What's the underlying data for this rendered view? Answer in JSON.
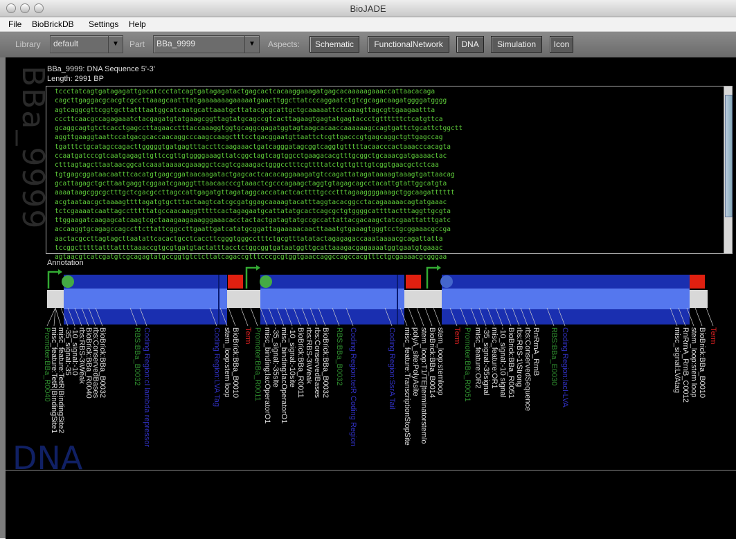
{
  "window": {
    "title": "BioJADE"
  },
  "menu": {
    "items": [
      "File",
      "BioBrickDB",
      "Settings",
      "Help"
    ]
  },
  "toolbar": {
    "library_label": "Library",
    "library_value": "default",
    "part_label": "Part",
    "part_value": "BBa_9999",
    "aspects_label": "Aspects:",
    "aspects": [
      "Schematic",
      "FunctionalNetwork",
      "DNA",
      "Simulation",
      "Icon"
    ]
  },
  "part_watermark": "BBa_9999",
  "aspect_watermark": "DNA",
  "sequence": {
    "header": "BBa_9999: DNA Sequence 5'-3'",
    "length": "Length: 2991 BP",
    "lines": [
      "tccctatcagtgatagagattgacatccctatcagtgatagagatactgagcactcacaaggaaagatgagcacaaaaagaaaccattaacacaga",
      "cagcttgaggacgcacgtcgccttaaagcaatttatgaaaaaaagaaaaatgaacttggcttatcccaggaatctgtcgcagacaagatggggatgggg",
      "agtcaggcgttcggtgcttatttaatggcatcaatgcattaaatgcttatacgcgcattgctgcaaaaattctcaaagttagcgttgaagaattta",
      "cccttcaacgccagagaaatctacgagatgtatgaagcggttagtatgcagccgtcacttagaagtgagtatgagtaccctgttttttctcatgttca",
      "gcaggcagtgtctcacctgagccttagaacctttaccaaaggtggtgcaggcgagatggtagtaagcacaaccaaaaaagccagtgattctgcattctggctt",
      "aggttgaaggtaattccatgacgcaccaacaggcccaagccaagctttcctgacggaatgttaattctcgttgacccgtgagcaggctgttgagccag",
      "tgatttctgcatagccagacttgggggtgatgagtttaccttcaagaaactgatcagggatagcggtcaggtgtttttacaacccactaaacccacagta",
      "ccaatgatcccgtcaatgagagttgttccgttgtggggaaagttatcggctagtcagtggcctgaagacacgtttgcggctgcaaacgatgaaaactac",
      "ctttagtagcttaataacggcatcaaataaaacgaaaggctcagtcgaaagactgggcctttcgttttatctgttgtttgtcggtgaacgctctcaa",
      "tgtgagcggataacaatttcacatgtgagcggataacaagatactgagcactcacacaggaaagatgtccagattatagataaaagtaaagtgattaacag",
      "gcattagagctgcttaatgaggtcggaatcgaaggtttaacaacccgtaaactcgcccagaagctaggtgtagagcagcctacattgtattggcatgta",
      "aaaataagcggcgctttgctcgacgccttagccattgagatgttagataggcaccatactcacttttgccctttagaaggggaaagctggcaagatttttt",
      "acgtaataacgctaaaagttttagatgtgctttactaagtcatcgcgatggagcaaaagtacatttaggtacacggcctacagaaaaacagtatgaaac",
      "tctcgaaaatcaattagcctttttatgccaacaaggtttttcactagagaatgcattatatgcactcagcgctgtggggcattttactttaggttgcgta",
      "ttggaagatcaagagcatcaagtcgctaaagaagaaagggaaacacctactactgatagtatgccgccattattacgacaagctatcgaattatttgatc",
      "accaaggtgcagagccagccttcttattcggccttgaattgatcatatgcggattagaaaaacaacttaaatgtgaaagtgggtcctgcggaaacgccga",
      "aactacgccttagtagcttaatattcacactgcctcaccttcgggtgggcctttctgcgtttatatactagagagaccaaataaaacgcagattatta",
      "tccggctttttatttattttaaaccgtgcgtgatgtactatttacctctggcggtgataatggttgcattaaagacgagaaaatggtgaatgtgaaac",
      "agtaacgtcatcgatgtcgcagagtatgccggtgtctcttatcagaccgtttcccgcgtggtgaaccaggccagccacgtttctgcgaaaacgcgggaa"
    ]
  },
  "annotation": {
    "label": "Annotation",
    "labels": [
      {
        "text": "Promoter:BBa_R0040",
        "color": "#2f8f2f"
      },
      {
        "text": "misc_feature:TetR|BindingSite1",
        "color": "#dddddd"
      },
      {
        "text": "misc_feature:TetR|BindingSite2",
        "color": "#dddddd"
      },
      {
        "text": "-35_signal:-35",
        "color": "#dddddd"
      },
      {
        "text": "-10_signal:-10",
        "color": "#dddddd"
      },
      {
        "text": "rbs:RBS-3\\Weak",
        "color": "#dddddd"
      },
      {
        "text": "BioBrick:BBa_R0040",
        "color": "#dddddd"
      },
      {
        "text": "rbs:ConservedBases",
        "color": "#dddddd"
      },
      {
        "text": "BioBrick:BBa_B0032",
        "color": "#dddddd"
      },
      {
        "text": "RBS:BBa_B0032",
        "color": "#2f8f2f"
      },
      {
        "text": "Coding Region:cI lambda repressor",
        "color": "#3030c0"
      },
      {
        "text": "Coding Region:LVA Tag",
        "color": "#3030c0"
      },
      {
        "text": "stem_loop:stem loop",
        "color": "#dddddd"
      },
      {
        "text": "BioBrick:BBa_B0010",
        "color": "#dddddd"
      },
      {
        "text": "Term",
        "color": "#d02020"
      },
      {
        "text": "Promoter:BBa_R0011",
        "color": "#2f8f2f"
      },
      {
        "text": "misc_binding:lacOperatorO1",
        "color": "#dddddd"
      },
      {
        "text": "-35_signal:-35site",
        "color": "#dddddd"
      },
      {
        "text": "misc_binding:lacOperatorO1",
        "color": "#dddddd"
      },
      {
        "text": "-10_signal:-10site",
        "color": "#dddddd"
      },
      {
        "text": "BioBrick:BBa_R0011",
        "color": "#dddddd"
      },
      {
        "text": "rbs:RBS-3\\Weak",
        "color": "#dddddd"
      },
      {
        "text": "rbs:ConservedBases",
        "color": "#dddddd"
      },
      {
        "text": "BioBrick:BBa_B0032",
        "color": "#dddddd"
      },
      {
        "text": "RBS:BBa_B0032",
        "color": "#2f8f2f"
      },
      {
        "text": "Coding Region:tetR Coding Region",
        "color": "#3030c0"
      },
      {
        "text": "Coding Region:SsrA Tail",
        "color": "#3030c0"
      },
      {
        "text": "misc_feature:TranscriptionStopSite",
        "color": "#dddddd"
      },
      {
        "text": "polyA_site:PolyAsite",
        "color": "#dddddd"
      },
      {
        "text": "stem_loop:T1/TE|terminatorstemlo",
        "color": "#dddddd"
      },
      {
        "text": "BioBrick:BBa_B0014",
        "color": "#dddddd"
      },
      {
        "text": "stem_loop:stemloop",
        "color": "#dddddd"
      },
      {
        "text": "Term",
        "color": "#d02020"
      },
      {
        "text": "Promoter:BBa_R0051",
        "color": "#2f8f2f"
      },
      {
        "text": "misc_feature:OR2",
        "color": "#dddddd"
      },
      {
        "text": "-35_signal:-35signal",
        "color": "#dddddd"
      },
      {
        "text": "misc_feature:OR1",
        "color": "#dddddd"
      },
      {
        "text": "-10_signal:-10 signal",
        "color": "#dddddd"
      },
      {
        "text": "BioBrick:BBa_R0051",
        "color": "#dddddd"
      },
      {
        "text": "rbs:RBS-1\\Strong",
        "color": "#dddddd"
      },
      {
        "text": "rbs:ConservedSequence",
        "color": "#dddddd"
      },
      {
        "text": "RnRrnA_RrnB",
        "color": "#dddddd"
      },
      {
        "text": "RBS:BBa_E0030",
        "color": "#2f8f2f"
      },
      {
        "text": "Coding Region:lacI-LVA",
        "color": "#3030c0"
      },
      {
        "text": "misc_signal:LVAtag",
        "color": "#dddddd"
      },
      {
        "text": "RnRrnA_RrnB_C0012",
        "color": "#dddddd"
      },
      {
        "text": "stem_loop:stem loop",
        "color": "#dddddd"
      },
      {
        "text": "BioBrick:BBa_B0010",
        "color": "#dddddd"
      },
      {
        "text": "Term",
        "color": "#d02020"
      }
    ]
  },
  "colors": {
    "coding_dark": "#1a2fb0",
    "coding_light": "#5577ee",
    "terminator": "#e02010",
    "promoter": "#33aa33",
    "rbs": "#44aa44",
    "backbone": "#d8d8d8",
    "sequence_text": "#5ecd3a"
  }
}
